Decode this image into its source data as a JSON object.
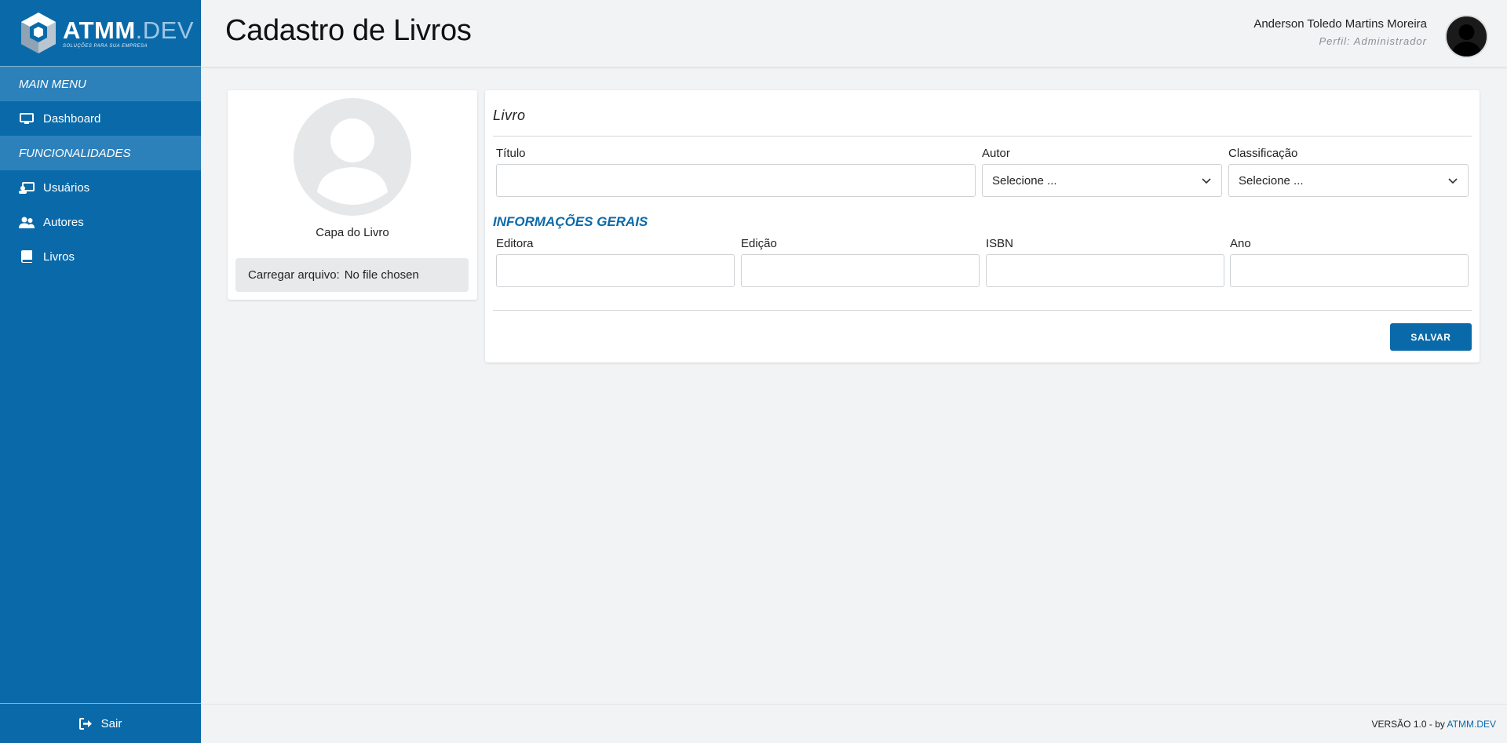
{
  "brand": {
    "name_main": "ATMM",
    "name_suffix": ".DEV",
    "tagline": "SOLUÇÕES PARA SUA EMPRESA"
  },
  "sidebar": {
    "sections": [
      {
        "title": "MAIN MENU",
        "items": [
          {
            "label": "Dashboard",
            "icon": "monitor-icon"
          }
        ]
      },
      {
        "title": "FUNCIONALIDADES",
        "items": [
          {
            "label": "Usuários",
            "icon": "users-screen-icon"
          },
          {
            "label": "Autores",
            "icon": "user-group-icon"
          },
          {
            "label": "Livros",
            "icon": "book-icon"
          }
        ]
      }
    ],
    "logout_label": "Sair"
  },
  "header": {
    "title": "Cadastro de Livros",
    "user_name": "Anderson Toledo Martins Moreira",
    "user_role": "Perfil: Administrador"
  },
  "cover": {
    "label": "Capa do Livro",
    "file_button": "Carregar arquivo:",
    "file_status": "No file chosen"
  },
  "form": {
    "heading": "Livro",
    "titulo_label": "Título",
    "titulo_value": "",
    "autor_label": "Autor",
    "autor_value": "Selecione ...",
    "classificacao_label": "Classificação",
    "classificacao_value": "Selecione ...",
    "section_title": "INFORMAÇÕES GERAIS",
    "editora_label": "Editora",
    "editora_value": "",
    "edicao_label": "Edição",
    "edicao_value": "",
    "isbn_label": "ISBN",
    "isbn_value": "",
    "ano_label": "Ano",
    "ano_value": "",
    "save_label": "SALVAR"
  },
  "footer": {
    "version_text": "VERSÃO 1.0 - by",
    "link_text": "ATMM.DEV"
  },
  "colors": {
    "primary": "#0a6aa9",
    "section_bg": "#2d81bb",
    "background": "#f2f3f5"
  }
}
